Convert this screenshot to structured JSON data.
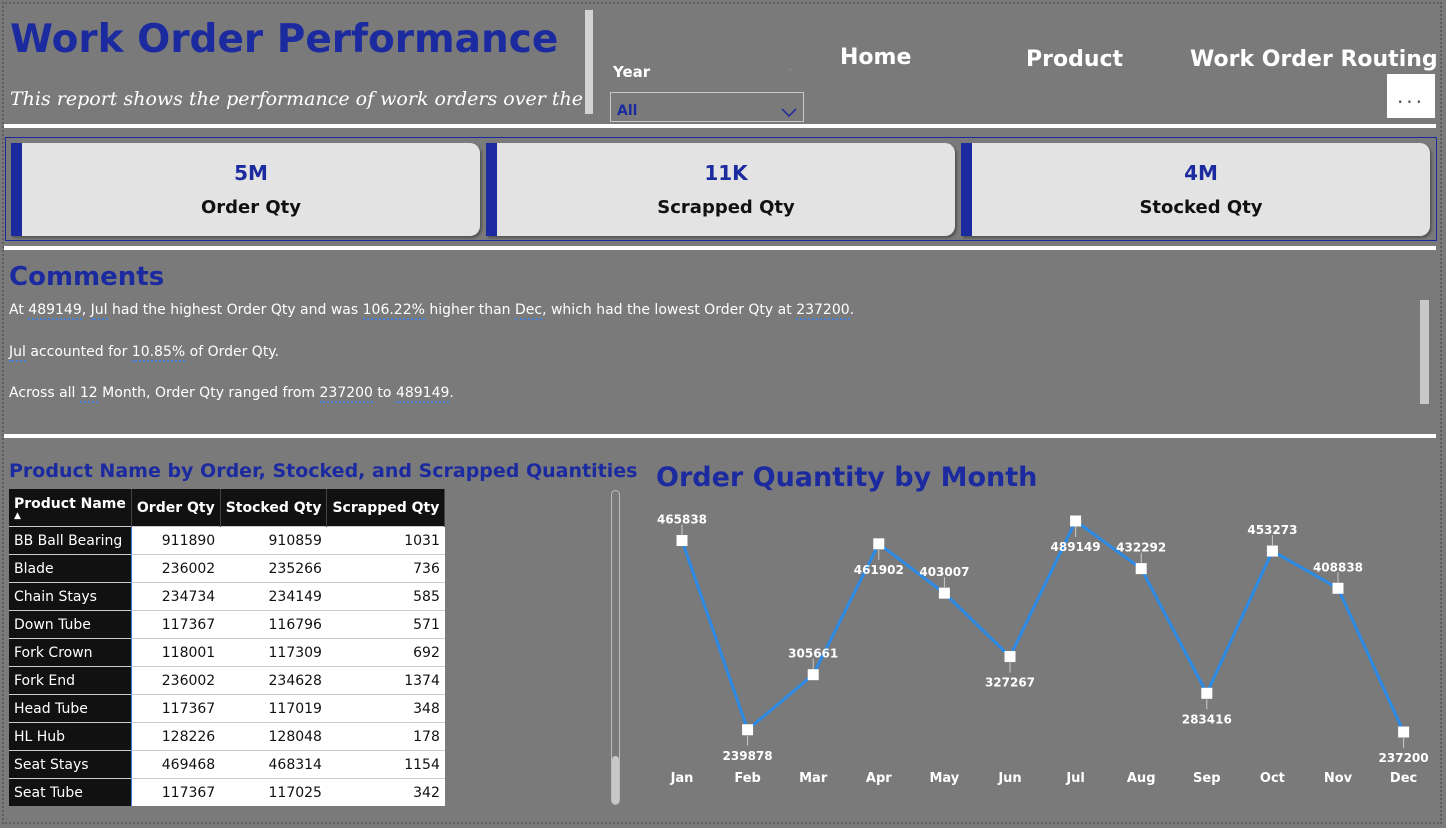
{
  "header": {
    "title": "Work Order Performance",
    "subtitle": "This report shows the performance of work orders over the"
  },
  "slicer": {
    "label": "Year",
    "value": "All"
  },
  "nav": {
    "home": "Home",
    "product": "Product",
    "routing": "Work Order Routing",
    "more": "..."
  },
  "kpis": [
    {
      "value": "5M",
      "label": "Order Qty"
    },
    {
      "value": "11K",
      "label": "Scrapped Qty"
    },
    {
      "value": "4M",
      "label": "Stocked Qty"
    }
  ],
  "comments": {
    "title": "Comments",
    "line1": {
      "p1": "At ",
      "v1": "489149",
      "p2": ", ",
      "v2": "Jul",
      "p3": " had the highest Order Qty and was ",
      "v3": "106.22%",
      "p4": " higher than ",
      "v4": "Dec",
      "p5": ", which had the lowest Order Qty at ",
      "v5": "237200",
      "p6": "."
    },
    "line2": {
      "v1": "Jul",
      "p1": " accounted for ",
      "v2": "10.85%",
      "p2": " of Order Qty."
    },
    "line3": {
      "p1": "Across all ",
      "v1": "12",
      "p2": " Month, Order Qty ranged from ",
      "v2": "237200",
      "p3": " to ",
      "v3": "489149",
      "p4": "."
    }
  },
  "table": {
    "title": "Product Name by Order, Stocked, and Scrapped Quantities",
    "columns": [
      "Product Name",
      "Order Qty",
      "Stocked Qty",
      "Scrapped Qty"
    ],
    "rows": [
      [
        "BB Ball Bearing",
        "911890",
        "910859",
        "1031"
      ],
      [
        "Blade",
        "236002",
        "235266",
        "736"
      ],
      [
        "Chain Stays",
        "234734",
        "234149",
        "585"
      ],
      [
        "Down Tube",
        "117367",
        "116796",
        "571"
      ],
      [
        "Fork Crown",
        "118001",
        "117309",
        "692"
      ],
      [
        "Fork End",
        "236002",
        "234628",
        "1374"
      ],
      [
        "Head Tube",
        "117367",
        "117019",
        "348"
      ],
      [
        "HL Hub",
        "128226",
        "128048",
        "178"
      ],
      [
        "Seat Stays",
        "469468",
        "468314",
        "1154"
      ],
      [
        "Seat Tube",
        "117367",
        "117025",
        "342"
      ]
    ]
  },
  "chart_data": {
    "type": "line",
    "title": "Order Quantity by Month",
    "categories": [
      "Jan",
      "Feb",
      "Mar",
      "Apr",
      "May",
      "Jun",
      "Jul",
      "Aug",
      "Sep",
      "Oct",
      "Nov",
      "Dec"
    ],
    "values": [
      465838,
      239878,
      305661,
      461902,
      403007,
      327267,
      489149,
      432292,
      283416,
      453273,
      408838,
      237200
    ],
    "ylim": [
      237200,
      489149
    ],
    "grid": false,
    "color": "#2b8ae6"
  },
  "colors": {
    "accent": "#1c2aa0",
    "background": "#7a7a7a",
    "card": "#e3e3e3",
    "line": "#2b8ae6"
  }
}
